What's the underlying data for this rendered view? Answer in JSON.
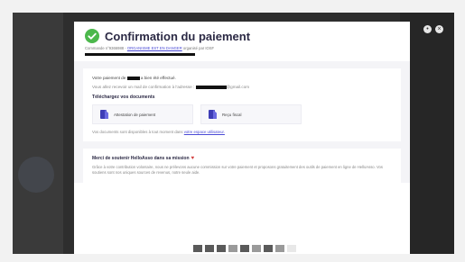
{
  "header": {
    "title": "Confirmation du paiement",
    "meta_prefix": "Commande n°9366988 - ",
    "meta_link": "ORGANISME EST EN DANGER",
    "meta_suffix": " organisé par IOSF"
  },
  "payment": {
    "line_prefix": "Votre paiement de ",
    "line_suffix": " a bien été effectué.",
    "email_prefix": "Vous allez recevoir un mail de confirmation à l'adresse : ",
    "email_suffix": "@gmail.com"
  },
  "documents": {
    "heading": "Téléchargez vos documents",
    "items": [
      {
        "label": "Attestation de paiement",
        "icon": "document-icon"
      },
      {
        "label": "Reçu fiscal",
        "icon": "document-icon"
      }
    ],
    "availability_prefix": "Vos documents sont disponibles à tout moment dans ",
    "availability_link": "votre espace utilisateur."
  },
  "support": {
    "title": "Merci de soutenir HelloAsso dans sa mission",
    "body": "Grâce à votre contribution volontaire, nous ne prélevons aucune commission sur votre paiement et proposons gratuitement des outils de paiement en ligne de HelloAsso. Vos soutiens sont nos uniques sources de revenus, notre seule aide."
  },
  "window": {
    "controls": [
      "minimize",
      "close"
    ]
  },
  "colors": {
    "accent": "#4cb84c",
    "title": "#2c2a45",
    "link": "#4a4ad6",
    "heart": "#d23b3b"
  }
}
